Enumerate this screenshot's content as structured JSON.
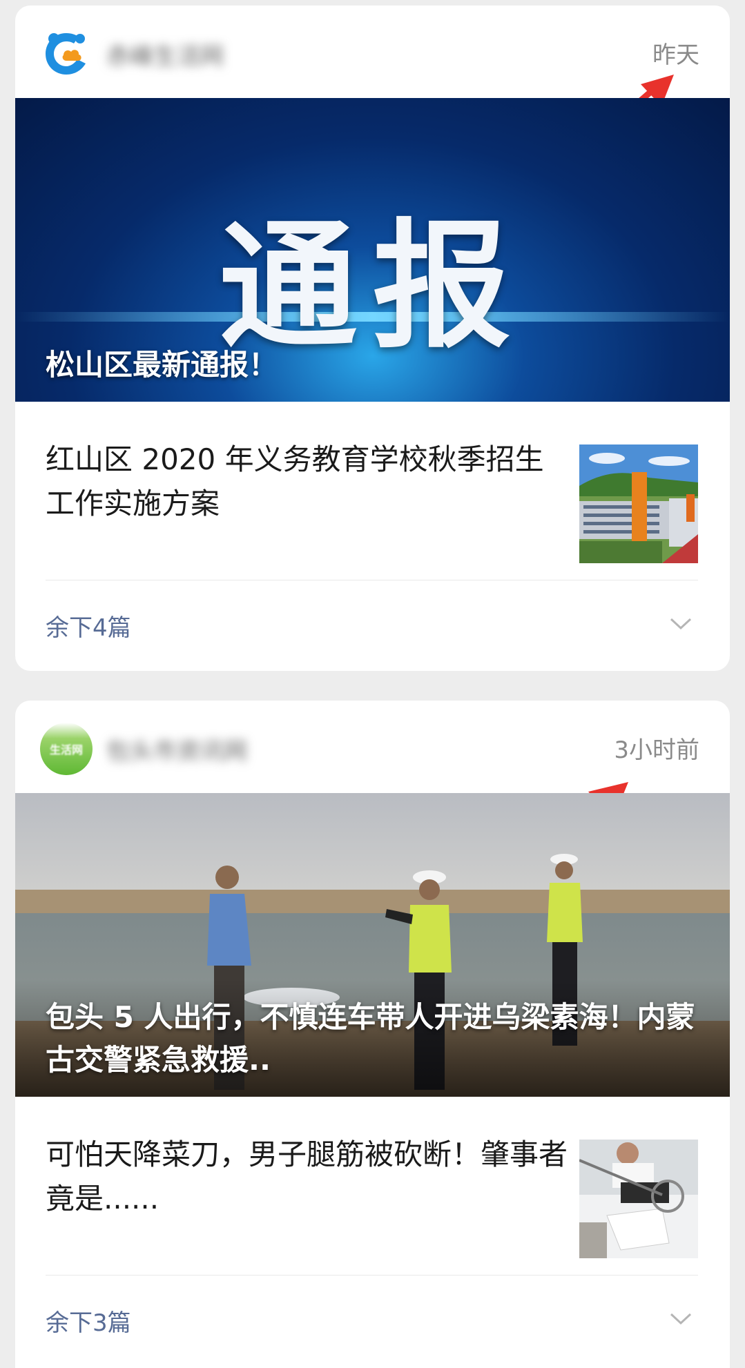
{
  "feed": [
    {
      "account": {
        "name": "赤峰生活网",
        "avatar_icon": "cloud-logo-icon"
      },
      "time": "昨天",
      "banner": {
        "big_text": "通报",
        "title": "松山区最新通报！"
      },
      "article": {
        "title": "红山区 2020 年义务教育学校秋季招生工作实施方案",
        "thumb_icon": "school-building-photo"
      },
      "more_label": "余下4篇"
    },
    {
      "account": {
        "name": "包头市资讯网",
        "avatar_text": "生活网"
      },
      "time": "3小时前",
      "banner": {
        "title": "包头 5 人出行，不慎连车带人开进乌梁素海！内蒙古交警紧急救援.."
      },
      "article": {
        "title": "可怕天降菜刀，男子腿筋被砍断！肇事者竟是......",
        "thumb_icon": "hospital-patient-photo"
      },
      "more_label": "余下3篇"
    }
  ],
  "colors": {
    "annotation_arrow": "#e8322c",
    "link_blue": "#576b95"
  }
}
